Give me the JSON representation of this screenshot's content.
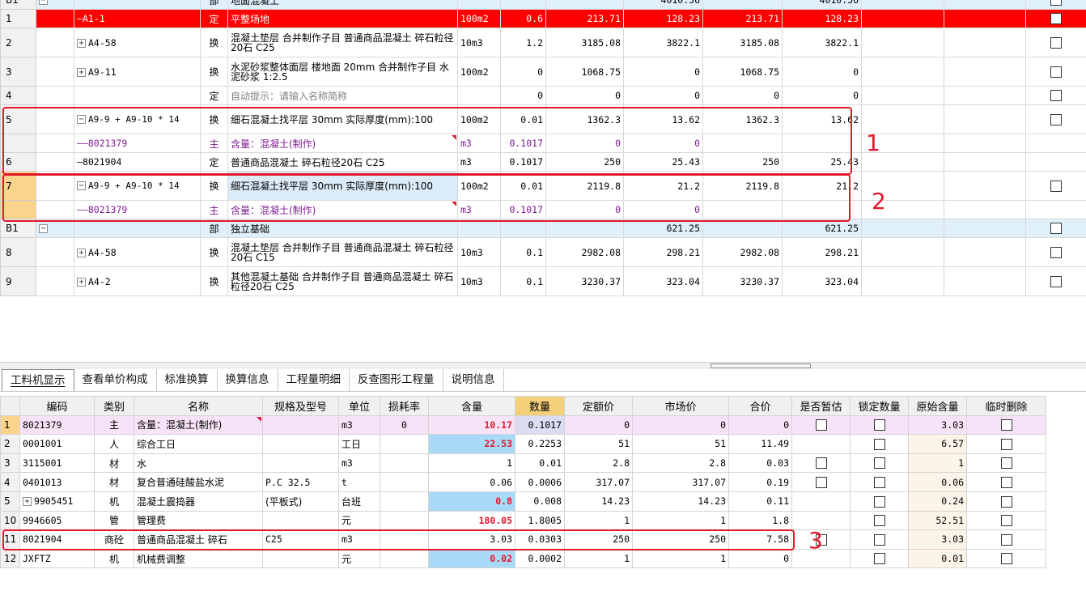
{
  "upper_rows": [
    {
      "hd": "B1",
      "kind": "section",
      "code": "",
      "type": "部",
      "name": "地面混凝土",
      "unit": "",
      "qty": "",
      "price": "4010.56",
      "total": "",
      "price2": "4010.56",
      "total2": ""
    },
    {
      "hd": "1",
      "kind": "red",
      "code": "A1-1",
      "type": "定",
      "name": "平整场地",
      "unit": "100m2",
      "qty": "0.6",
      "price": "213.71",
      "total": "128.23",
      "price2": "213.71",
      "total2": "128.23"
    },
    {
      "hd": "2",
      "code": "A4-58",
      "type": "换",
      "name": "混凝土垫层 合并制作子目 普通商品混凝土 碎石粒径20石 C25",
      "unit": "10m3",
      "qty": "1.2",
      "price": "3185.08",
      "total": "3822.1",
      "price2": "3185.08",
      "total2": "3822.1"
    },
    {
      "hd": "3",
      "code": "A9-11",
      "type": "换",
      "name": "水泥砂浆整体面层 楼地面 20mm 合并制作子目 水泥砂浆 1:2.5",
      "unit": "100m2",
      "qty": "0",
      "price": "1068.75",
      "total": "0",
      "price2": "1068.75",
      "total2": "0"
    },
    {
      "hd": "4",
      "code": "",
      "type": "定",
      "name": "自动提示：请输入名称简称",
      "unit": "",
      "qty": "0",
      "price": "0",
      "total": "0",
      "price2": "0",
      "total2": "0"
    },
    {
      "hd": "5",
      "code": "A9-9 + A9-10 * 14",
      "type": "换",
      "name": "细石混凝土找平层 30mm  实际厚度(mm):100",
      "unit": "100m2",
      "qty": "0.01",
      "price": "1362.3",
      "total": "13.62",
      "price2": "1362.3",
      "total2": "13.62"
    },
    {
      "hd": "",
      "kind": "sub",
      "code": "8021379",
      "type": "主",
      "name": "含量：混凝土(制作)",
      "unit": "m3",
      "qty": "0.1017",
      "price": "0",
      "total": "0",
      "price2": "",
      "total2": ""
    },
    {
      "hd": "6",
      "code": "8021904",
      "type": "定",
      "name": "普通商品混凝土 碎石粒径20石 C25",
      "unit": "m3",
      "qty": "0.1017",
      "price": "250",
      "total": "25.43",
      "price2": "250",
      "total2": "25.43"
    },
    {
      "hd": "7",
      "kind": "selected",
      "code": "A9-9 + A9-10 * 14",
      "type": "换",
      "name": "细石混凝土找平层 30mm  实际厚度(mm):100",
      "unit": "100m2",
      "qty": "0.01",
      "price": "2119.8",
      "total": "21.2",
      "price2": "2119.8",
      "total2": "21.2"
    },
    {
      "hd": "",
      "kind": "sub",
      "code": "8021379",
      "type": "主",
      "name": "含量：混凝土(制作)",
      "unit": "m3",
      "qty": "0.1017",
      "price": "0",
      "total": "0",
      "price2": "",
      "total2": ""
    },
    {
      "hd": "B1",
      "kind": "section",
      "code": "",
      "type": "部",
      "name": "独立基础",
      "unit": "",
      "qty": "",
      "price": "621.25",
      "total": "",
      "price2": "621.25",
      "total2": ""
    },
    {
      "hd": "8",
      "code": "A4-58",
      "type": "换",
      "name": "混凝土垫层 合并制作子目 普通商品混凝土 碎石粒径20石 C15",
      "unit": "10m3",
      "qty": "0.1",
      "price": "2982.08",
      "total": "298.21",
      "price2": "2982.08",
      "total2": "298.21"
    },
    {
      "hd": "9",
      "code": "A4-2",
      "type": "换",
      "name": "其他混凝土基础 合并制作子目 普通商品混凝土 碎石粒径20石 C25",
      "unit": "10m3",
      "qty": "0.1",
      "price": "3230.37",
      "total": "323.04",
      "price2": "3230.37",
      "total2": "323.04"
    }
  ],
  "tabs": [
    "工料机显示",
    "查看单价构成",
    "标准换算",
    "换算信息",
    "工程量明细",
    "反查图形工程量",
    "说明信息"
  ],
  "lower_headers": [
    "编码",
    "类别",
    "名称",
    "规格及型号",
    "单位",
    "损耗率",
    "含量",
    "数量",
    "定额价",
    "市场价",
    "合价",
    "是否暂估",
    "锁定数量",
    "原始含量",
    "临时删除"
  ],
  "lower_rows": [
    {
      "hd": "1",
      "code": "8021379",
      "cat": "主",
      "name": "含量：混凝土(制作)",
      "spec": "",
      "unit": "m3",
      "loss": "0",
      "content": "10.17",
      "qty": "0.1017",
      "base": "0",
      "market": "0",
      "sum": "0",
      "orig": "3.03"
    },
    {
      "hd": "2",
      "code": "0001001",
      "cat": "人",
      "name": "综合工日",
      "spec": "",
      "unit": "工日",
      "loss": "",
      "content": "22.53",
      "qty": "0.2253",
      "base": "51",
      "market": "51",
      "sum": "11.49",
      "orig": "6.57"
    },
    {
      "hd": "3",
      "code": "3115001",
      "cat": "材",
      "name": "水",
      "spec": "",
      "unit": "m3",
      "loss": "",
      "content": "1",
      "qty": "0.01",
      "base": "2.8",
      "market": "2.8",
      "sum": "0.03",
      "orig": "1"
    },
    {
      "hd": "4",
      "code": "0401013",
      "cat": "材",
      "name": "复合普通硅酸盐水泥",
      "spec": "P.C 32.5",
      "unit": "t",
      "loss": "",
      "content": "0.06",
      "qty": "0.0006",
      "base": "317.07",
      "market": "317.07",
      "sum": "0.19",
      "orig": "0.06"
    },
    {
      "hd": "5",
      "code": "9905451",
      "cat": "机",
      "name": "混凝土震捣器",
      "spec": "(平板式)",
      "unit": "台班",
      "loss": "",
      "content": "0.8",
      "qty": "0.008",
      "base": "14.23",
      "market": "14.23",
      "sum": "0.11",
      "orig": "0.24"
    },
    {
      "hd": "10",
      "code": "9946605",
      "cat": "管",
      "name": "管理费",
      "spec": "",
      "unit": "元",
      "loss": "",
      "content": "180.05",
      "qty": "1.8005",
      "base": "1",
      "market": "1",
      "sum": "1.8",
      "orig": "52.51"
    },
    {
      "hd": "11",
      "code": "8021904",
      "cat": "商砼",
      "name": "普通商品混凝土 碎石",
      "spec": "C25",
      "unit": "m3",
      "loss": "",
      "content": "3.03",
      "qty": "0.0303",
      "base": "250",
      "market": "250",
      "sum": "7.58",
      "orig": "3.03"
    },
    {
      "hd": "12",
      "code": "JXFTZ",
      "cat": "机",
      "name": "机械费调整",
      "spec": "",
      "unit": "元",
      "loss": "",
      "content": "0.02",
      "qty": "0.0002",
      "base": "1",
      "market": "1",
      "sum": "0",
      "orig": "0.01"
    }
  ],
  "annotations": [
    "1",
    "2",
    "3"
  ],
  "colors": {
    "accent_red": "#e3172b",
    "section_bg": "#dff0fa",
    "selected_row": "#f9d48a",
    "highlight_blue": "#a8d9f7"
  }
}
